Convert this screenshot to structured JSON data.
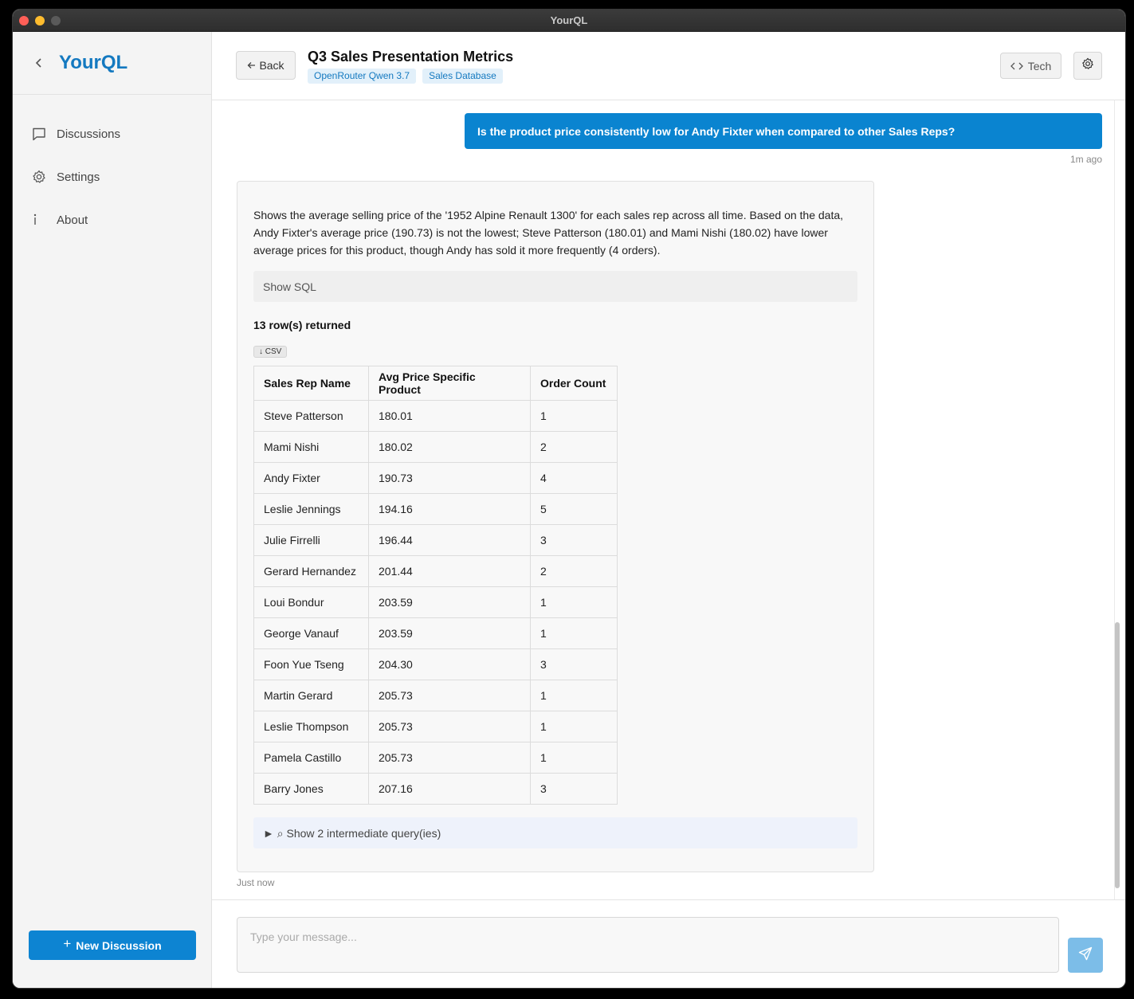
{
  "window": {
    "title": "YourQL"
  },
  "sidebar": {
    "brand": "YourQL",
    "items": [
      {
        "label": "Discussions",
        "icon": "chat-bubble-icon"
      },
      {
        "label": "Settings",
        "icon": "gear-icon"
      },
      {
        "label": "About",
        "icon": "info-icon"
      }
    ],
    "new_discussion": "New Discussion"
  },
  "header": {
    "back_label": "Back",
    "title": "Q3 Sales Presentation Metrics",
    "tags": [
      "OpenRouter Qwen 3.7",
      "Sales Database"
    ],
    "tech_label": "Tech"
  },
  "chat": {
    "user_message": "Is the product price consistently low for Andy Fixter when compared to other Sales Reps?",
    "user_time": "1m ago",
    "bot": {
      "text": "Shows the average selling price of the '1952 Alpine Renault 1300' for each sales rep across all time. Based on the data, Andy Fixter's average price (190.73) is not the lowest; Steve Patterson (180.01) and Mami Nishi (180.02) have lower average prices for this product, though Andy has sold it more frequently (4 orders).",
      "show_sql": "Show SQL",
      "rows_returned": "13 row(s) returned",
      "csv_label": "↓ CSV",
      "table": {
        "columns": [
          "Sales Rep Name",
          "Avg Price Specific Product",
          "Order Count"
        ],
        "rows": [
          [
            "Steve Patterson",
            "180.01",
            "1"
          ],
          [
            "Mami Nishi",
            "180.02",
            "2"
          ],
          [
            "Andy Fixter",
            "190.73",
            "4"
          ],
          [
            "Leslie Jennings",
            "194.16",
            "5"
          ],
          [
            "Julie Firrelli",
            "196.44",
            "3"
          ],
          [
            "Gerard Hernandez",
            "201.44",
            "2"
          ],
          [
            "Loui Bondur",
            "203.59",
            "1"
          ],
          [
            "George Vanauf",
            "203.59",
            "1"
          ],
          [
            "Foon Yue Tseng",
            "204.30",
            "3"
          ],
          [
            "Martin Gerard",
            "205.73",
            "1"
          ],
          [
            "Leslie Thompson",
            "205.73",
            "1"
          ],
          [
            "Pamela Castillo",
            "205.73",
            "1"
          ],
          [
            "Barry Jones",
            "207.16",
            "3"
          ]
        ]
      },
      "intermediate": "► ⌕ Show 2 intermediate query(ies)",
      "time": "Just now"
    }
  },
  "composer": {
    "placeholder": "Type your message..."
  },
  "colors": {
    "accent": "#0d84d2",
    "brand": "#1479c0",
    "send_disabled": "#7cbde8"
  }
}
